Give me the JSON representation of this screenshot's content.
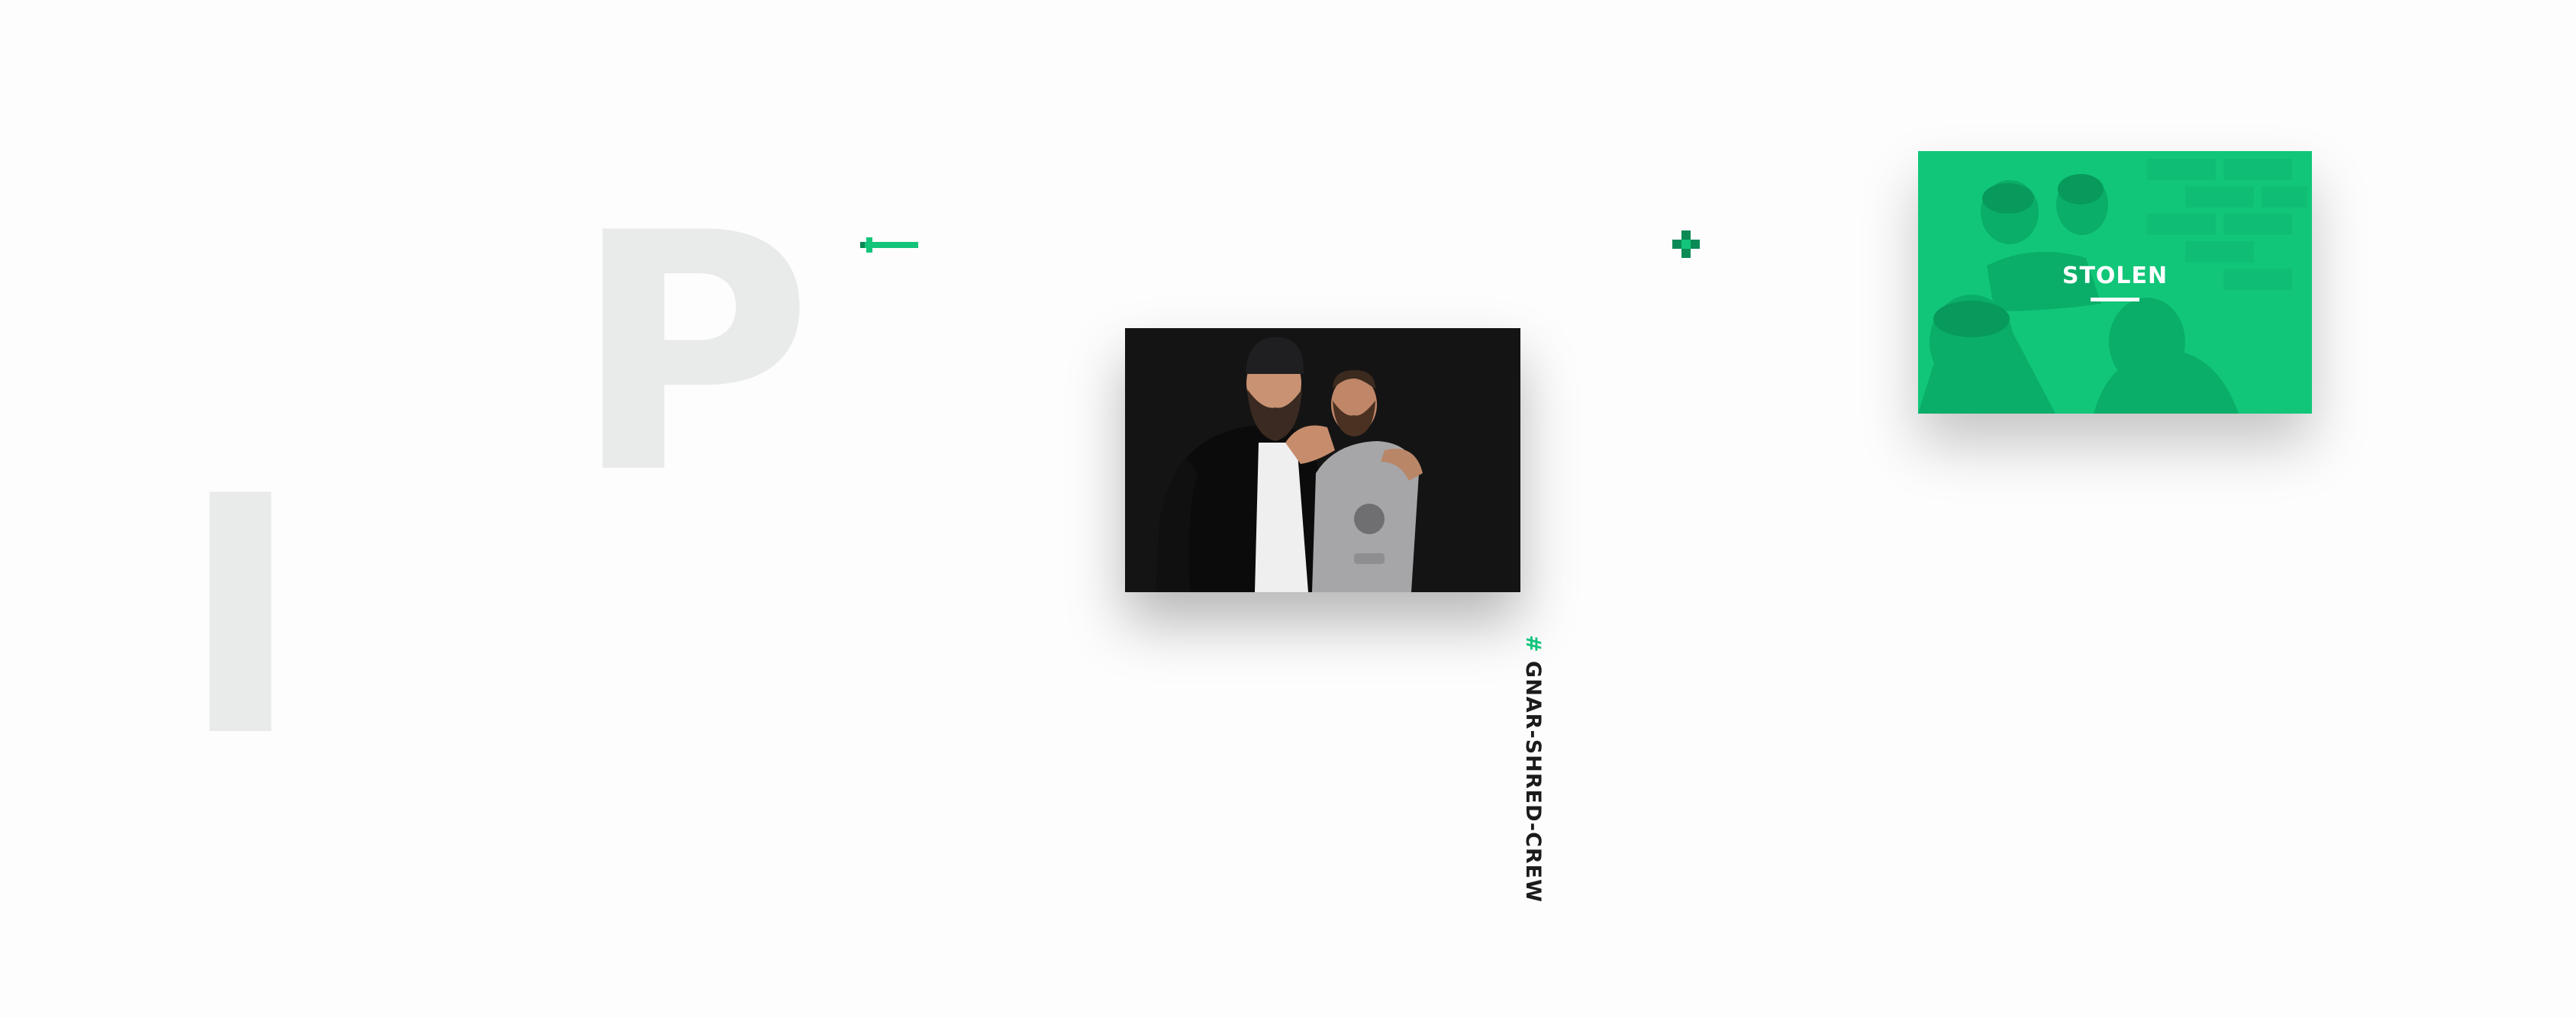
{
  "background_letters": {
    "first": "P",
    "second": "I"
  },
  "navigation": {
    "prev_icon": "arrow-left-icon",
    "next_icon": "plus-cross-icon"
  },
  "photo": {
    "description_icon": "photo-two-men"
  },
  "hashtag": {
    "symbol": "#",
    "text": "GNAR-SHRED-CREW"
  },
  "project_card": {
    "title": "STOLEN"
  },
  "colors": {
    "accent": "#13c47b",
    "accent_dark": "#0b8a55",
    "card_green": "#11c679",
    "letter_gray": "#e9eaea",
    "photo_bg": "#141313"
  }
}
